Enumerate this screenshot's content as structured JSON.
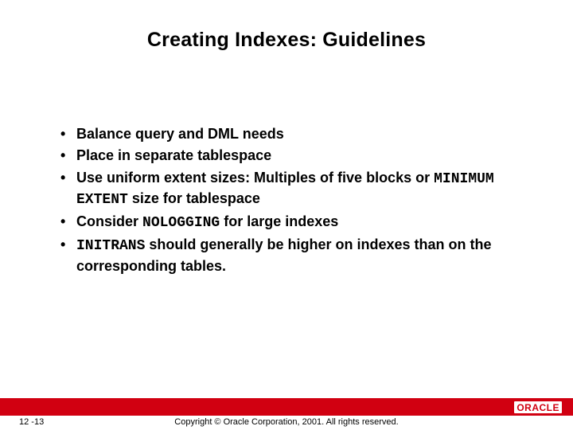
{
  "title": "Creating Indexes: Guidelines",
  "bullets": {
    "b1": "Balance query and DML needs",
    "b2": "Place in separate tablespace",
    "b3_a": "Use uniform extent sizes: Multiples of five blocks or ",
    "b3_code": "MINIMUM EXTENT",
    "b3_b": " size for tablespace",
    "b4_a": "Consider ",
    "b4_code": "NOLOGGING",
    "b4_b": " for large indexes",
    "b5_code": "INITRANS",
    "b5_a": " should generally be higher on indexes than on the corresponding tables."
  },
  "footer": {
    "page": "12 -13",
    "copyright": "Copyright © Oracle Corporation, 2001. All rights reserved.",
    "logo_text": "ORACLE"
  }
}
